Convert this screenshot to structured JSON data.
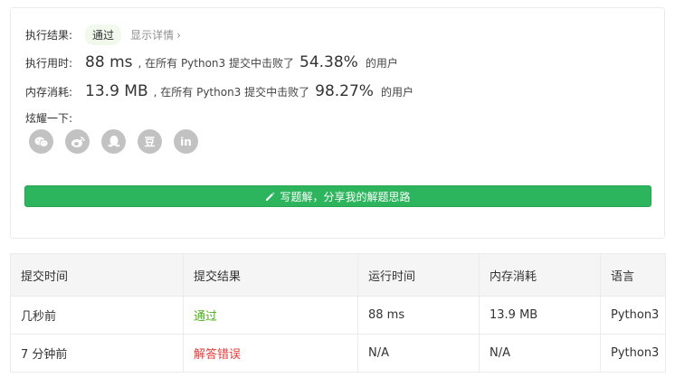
{
  "result": {
    "label": "执行结果:",
    "status": "通过",
    "details_link": "显示详情",
    "chevron": "›"
  },
  "runtime": {
    "label": "执行用时:",
    "value": "88 ms",
    "prefix": ", 在所有 Python3 提交中击败了",
    "percent": "54.38%",
    "suffix": "的用户"
  },
  "memory": {
    "label": "内存消耗:",
    "value": "13.9 MB",
    "prefix": ", 在所有 Python3 提交中击败了",
    "percent": "98.27%",
    "suffix": "的用户"
  },
  "share": {
    "label": "炫耀一下:",
    "icons": [
      "wechat-icon",
      "weibo-icon",
      "qq-icon",
      "douban-icon",
      "linkedin-icon"
    ],
    "douban_glyph": "豆",
    "linkedin_glyph": "in"
  },
  "write_solution_button": "写题解，分享我的解题思路",
  "colors": {
    "accent": "#2db55d",
    "ok": "#4cae1c",
    "error": "#e33c39"
  },
  "table": {
    "headers": [
      "提交时间",
      "提交结果",
      "运行时间",
      "内存消耗",
      "语言"
    ],
    "rows": [
      [
        "几秒前",
        "通过",
        "88 ms",
        "13.9 MB",
        "Python3"
      ],
      [
        "7 分钟前",
        "解答错误",
        "N/A",
        "N/A",
        "Python3"
      ]
    ]
  }
}
